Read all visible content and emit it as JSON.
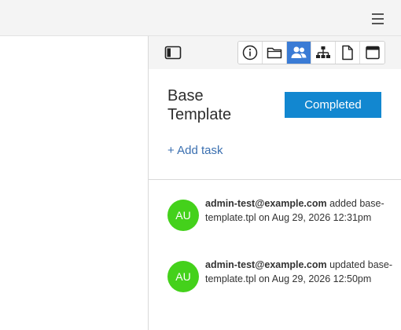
{
  "panel": {
    "title": "Base Template",
    "status_label": "Completed",
    "add_task_label": "+ Add task"
  },
  "toolbar": {
    "tabs": [
      {
        "icon": "info-icon"
      },
      {
        "icon": "folder-icon"
      },
      {
        "icon": "users-icon",
        "active": true
      },
      {
        "icon": "hierarchy-icon"
      },
      {
        "icon": "document-icon"
      },
      {
        "icon": "calendar-icon"
      }
    ]
  },
  "activity": [
    {
      "avatar": "AU",
      "user": "admin-test@example.com",
      "action": "added",
      "detail": "base-template.tpl on Aug 29, 2026 12:31pm"
    },
    {
      "avatar": "AU",
      "user": "admin-test@example.com",
      "action": "updated",
      "detail": "base-template.tpl on Aug 29, 2026 12:50pm"
    }
  ],
  "colors": {
    "accent": "#1287d0",
    "active_tab": "#3a7bd5",
    "avatar": "#44d11b",
    "link": "#3a6fb0"
  }
}
